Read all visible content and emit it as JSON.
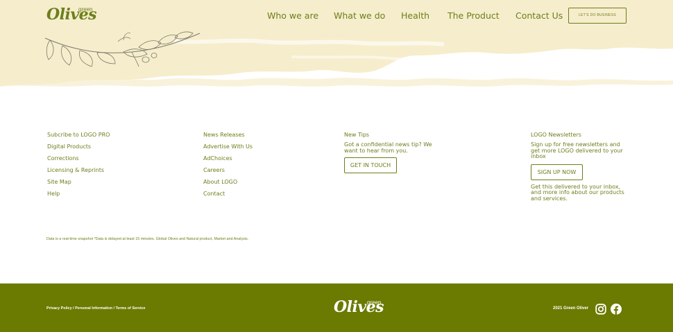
{
  "brand": {
    "name": "Olives",
    "tag": "green",
    "footer_name": "Olives",
    "footer_tag": "green"
  },
  "nav": {
    "items": [
      "Who we are",
      "What we do",
      "Health",
      "The Product",
      "Contact Us"
    ],
    "cta": "LET'S DO BUSINESS"
  },
  "columns": {
    "col1": [
      "Subcribe to LOGO PRO",
      "Digital Products",
      "Corrections",
      "Licensing & Reprints",
      "Site Map",
      "Help"
    ],
    "col2": [
      "News Releases",
      "Advertise With Us",
      "AdChoices",
      "Careers",
      "About LOGO",
      "Contact"
    ],
    "tips": {
      "heading": "New Tips",
      "text": "Got a confidential news tip? We want to hear from you.",
      "button": "GET IN TOUCH"
    },
    "newsletters": {
      "heading": "LOGO Newsletters",
      "text": "Sign up for free newsletters and get more LOGO delivered to your inbox",
      "button": "SIGN UP NOW",
      "note": "Get this delivered to your inbox, and more info about our products and services."
    }
  },
  "disclaimer": "Data is a real-time snapshot *Data is delayed at least 15 minutes. Global Olives and Natural product, Market and Analysis.",
  "footer": {
    "legal": [
      "Privacy Policy",
      "Personal Information",
      "Terms of Service"
    ],
    "legal_sep": " / ",
    "copyright": "2021 Green Oliver",
    "social_icons": [
      "instagram-icon",
      "facebook-icon"
    ]
  },
  "colors": {
    "brand_green": "#6b7f1c",
    "footer_bg": "#6b7a00",
    "header_bg": "#f6edcc"
  }
}
